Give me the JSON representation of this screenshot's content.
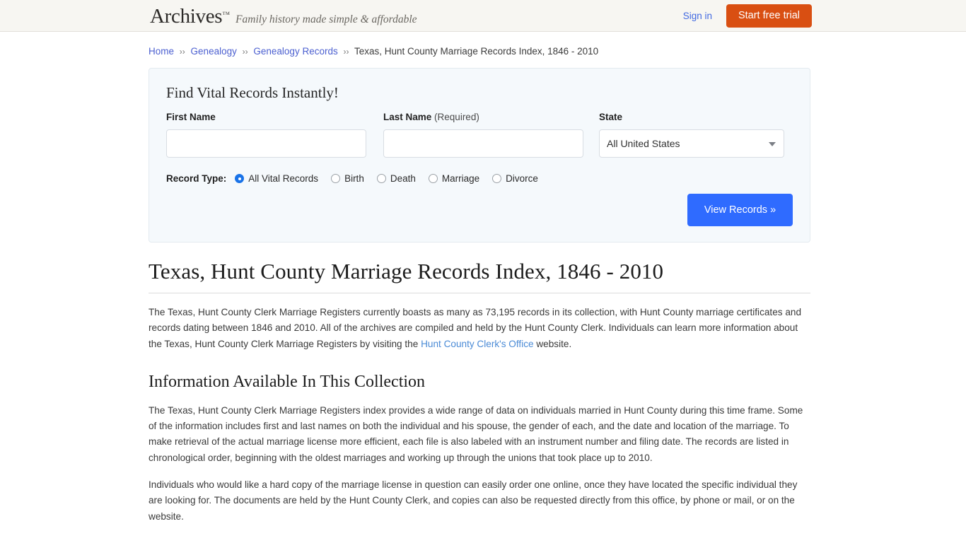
{
  "header": {
    "logo": "Archives",
    "logo_tm": "™",
    "tagline": "Family history made simple & affordable",
    "sign_in": "Sign in",
    "start_trial": "Start free trial",
    "trial_color": "#d94f12"
  },
  "breadcrumb": {
    "items": [
      {
        "label": "Home",
        "link": true
      },
      {
        "label": "Genealogy",
        "link": true
      },
      {
        "label": "Genealogy Records",
        "link": true
      },
      {
        "label": "Texas, Hunt County Marriage Records Index, 1846 - 2010",
        "link": false
      }
    ],
    "separator": "››"
  },
  "search_panel": {
    "title": "Find Vital Records Instantly!",
    "first_name": {
      "label": "First Name",
      "value": "",
      "placeholder": ""
    },
    "last_name": {
      "label": "Last Name",
      "required_note": "(Required)",
      "value": "",
      "placeholder": ""
    },
    "state": {
      "label": "State",
      "selected": "All United States"
    },
    "record_type": {
      "label": "Record Type:",
      "options": [
        {
          "label": "All Vital Records",
          "checked": true
        },
        {
          "label": "Birth",
          "checked": false
        },
        {
          "label": "Death",
          "checked": false
        },
        {
          "label": "Marriage",
          "checked": false
        },
        {
          "label": "Divorce",
          "checked": false
        }
      ]
    },
    "submit_label": "View Records »",
    "submit_color": "#2f6bff"
  },
  "article": {
    "title": "Texas, Hunt County Marriage Records Index, 1846 - 2010",
    "intro_part1": "The Texas, Hunt County Clerk Marriage Registers currently boasts as many as 73,195 records in its collection, with Hunt County marriage certificates and records dating between 1846 and 2010. All of the archives are compiled and held by the Hunt County Clerk. Individuals can learn more information about the Texas, Hunt County Clerk Marriage Registers by visiting the ",
    "intro_link": "Hunt County Clerk's Office",
    "intro_part2": " website.",
    "section_heading": "Information Available In This Collection",
    "paragraph_1": "The Texas, Hunt County Clerk Marriage Registers index provides a wide range of data on individuals married in Hunt County during this time frame. Some of the information includes first and last names on both the individual and his spouse, the gender of each, and the date and location of the marriage. To make retrieval of the actual marriage license more efficient, each file is also labeled with an instrument number and filing date. The records are listed in chronological order, beginning with the oldest marriages and working up through the unions that took place up to 2010.",
    "paragraph_2": "Individuals who would like a hard copy of the marriage license in question can easily order one online, once they have located the specific individual they are looking for. The documents are held by the Hunt County Clerk, and copies can also be requested directly from this office, by phone or mail, or on the website."
  }
}
